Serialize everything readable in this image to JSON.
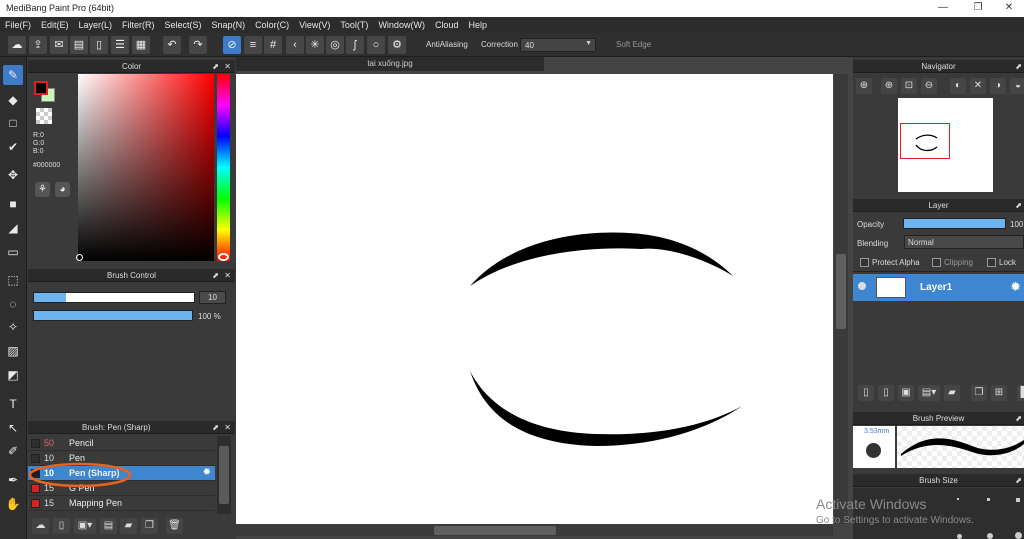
{
  "window": {
    "title": "MediBang Paint Pro (64bit)",
    "minimize": "—",
    "maximize": "❐",
    "close": "✕"
  },
  "menu": [
    "File(F)",
    "Edit(E)",
    "Layer(L)",
    "Filter(R)",
    "Select(S)",
    "Snap(N)",
    "Color(C)",
    "View(V)",
    "Tool(T)",
    "Window(W)",
    "Cloud",
    "Help"
  ],
  "toolbar": {
    "antialiasing_label": "AntiAliasing",
    "correction_label": "Correction",
    "correction_value": "40",
    "softedge_label": "Soft Edge",
    "antialiasing_checked": true,
    "softedge_checked": false
  },
  "color_panel": {
    "title": "Color",
    "rgb": [
      "R:0",
      "G:0",
      "B:0"
    ],
    "hex": "#000000",
    "primary_color": "#000000",
    "secondary_color": "#c8f5c0",
    "pin": "⬈",
    "close": "✕"
  },
  "brush_control": {
    "title": "Brush Control",
    "size_value": "10",
    "size_fill": 0.2,
    "opacity_value": "100 %",
    "opacity_fill": 1.0
  },
  "brush_list": {
    "title": "Brush: Pen (Sharp)",
    "items": [
      {
        "size": "50",
        "name": "Pencil",
        "color": "#2f2f2f",
        "size_color": "#e06666"
      },
      {
        "size": "10",
        "name": "Pen",
        "color": "#2f2f2f",
        "size_color": "#dddddd"
      },
      {
        "size": "10",
        "name": "Pen (Sharp)",
        "color": "#1f1f1f",
        "size_color": "#ffffff"
      },
      {
        "size": "15",
        "name": "G Pen",
        "color": "#e02020",
        "size_color": "#dddddd"
      },
      {
        "size": "15",
        "name": "Mapping Pen",
        "color": "#e02020",
        "size_color": "#dddddd"
      }
    ]
  },
  "document": {
    "tab_title": "tai xuống.jpg"
  },
  "navigator": {
    "title": "Navigator"
  },
  "layer_panel": {
    "title": "Layer",
    "opacity_label": "Opacity",
    "opacity_value": "100",
    "opacity_fill": 1.0,
    "blending_label": "Blending",
    "blending_value": "Normal",
    "protect_alpha": "Protect Alpha",
    "clipping": "Clipping",
    "lock": "Lock",
    "layers": [
      {
        "name": "Layer1"
      }
    ]
  },
  "brush_preview": {
    "title": "Brush Preview",
    "size_text": "3.53mm"
  },
  "brush_size": {
    "title": "Brush Size"
  },
  "watermark": {
    "line1": "Activate Windows",
    "line2": "Go to Settings to activate Windows."
  },
  "colors": {
    "accent": "#3e7bc9",
    "selection": "#3e86cf",
    "highlight_circle": "#e8641e",
    "nav_frame": "#e02020"
  }
}
